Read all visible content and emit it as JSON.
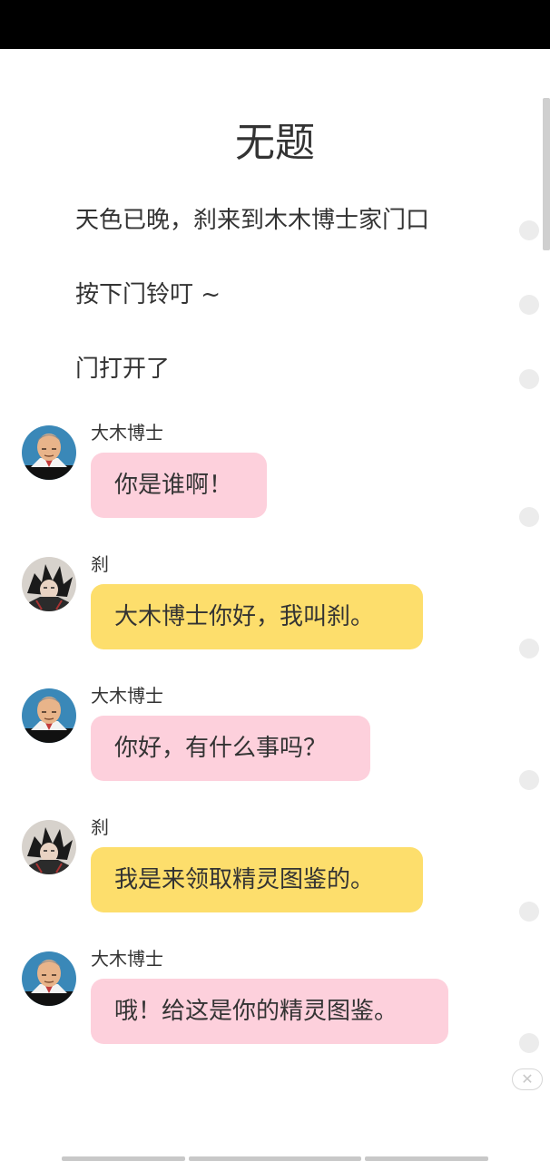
{
  "story": {
    "title": "无题",
    "narration": [
      "天色已晚，刹来到木木博士家门口",
      "按下门铃叮 ~",
      "门打开了"
    ],
    "messages": [
      {
        "speaker": "大木博士",
        "text": "你是谁啊！",
        "style": "pink"
      },
      {
        "speaker": "刹",
        "text": "大木博士你好，我叫刹。",
        "style": "yellow"
      },
      {
        "speaker": "大木博士",
        "text": "你好，有什么事吗？",
        "style": "pink"
      },
      {
        "speaker": "刹",
        "text": "我是来领取精灵图鉴的。",
        "style": "yellow"
      },
      {
        "speaker": "大木博士",
        "text": "哦！给这是你的精灵图鉴。",
        "style": "pink"
      }
    ]
  },
  "controls": {
    "close_icon": "close-icon",
    "close_symbol": "✕"
  },
  "colors": {
    "pink_bubble": "#fdd0dc",
    "yellow_bubble": "#fdde6c",
    "text": "#333333",
    "status_bar": "#000000"
  }
}
